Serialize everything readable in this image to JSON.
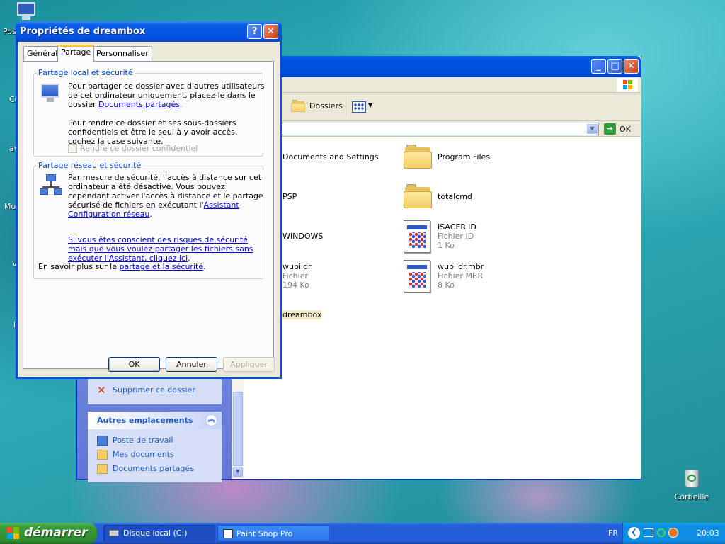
{
  "desktop": {
    "icons": [
      {
        "label": "Corbeille",
        "icon": "recycle-bin-icon"
      }
    ],
    "fragments": [
      "Pos",
      "Co",
      "av",
      "Mo",
      "V",
      "I"
    ]
  },
  "explorer": {
    "address_go": "OK",
    "toolbar": {
      "folders_label": "Dossiers"
    },
    "tasks": {
      "delete_folder": "Supprimer ce dossier",
      "other_places_title": "Autres emplacements",
      "other_places": [
        "Poste de travail",
        "Mes documents",
        "Documents partagés"
      ]
    },
    "files": [
      {
        "name": "Documents and Settings",
        "kind": "folder"
      },
      {
        "name": "Program Files",
        "kind": "folder"
      },
      {
        "name": "PSP",
        "kind": "folder"
      },
      {
        "name": "totalcmd",
        "kind": "folder"
      },
      {
        "name": "WINDOWS",
        "kind": "folder"
      },
      {
        "name": "ISACER.ID",
        "type": "Fichier ID",
        "size": "1 Ko",
        "kind": "file"
      },
      {
        "name": "wubildr",
        "type": "Fichier",
        "size": "194 Ko",
        "kind": "file"
      },
      {
        "name": "wubildr.mbr",
        "type": "Fichier MBR",
        "size": "8 Ko",
        "kind": "file"
      },
      {
        "name": "dreambox",
        "kind": "folder"
      }
    ]
  },
  "dialog": {
    "title": "Propriétés de dreambox",
    "tabs": [
      "Général",
      "Partage",
      "Personnaliser"
    ],
    "active_tab": "Partage",
    "local_group": {
      "title": "Partage local et sécurité",
      "p1_text": "Pour partager ce dossier avec d'autres utilisateurs de cet ordinateur uniquement, placez-le dans le dossier",
      "p1_link": "Documents partagés",
      "p1_end": ".",
      "p2_text": "Pour rendre ce dossier et ses sous-dossiers confidentiels et être le seul à y avoir accès, cochez la case suivante.",
      "checkbox_label": "Rendre ce dossier confidentiel",
      "checkbox_checked": false
    },
    "network_group": {
      "title": "Partage réseau et sécurité",
      "p1_text": "Par mesure de sécurité, l'accès à distance sur cet ordinateur a été désactivé. Vous pouvez cependant activer l'accès à distance et le partage sécurisé de fichiers en exécutant l'",
      "p1_link": "Assistant Configuration réseau",
      "p1_end": ".",
      "risk_link": "Si vous êtes conscient des risques de sécurité mais que vous voulez partager les fichiers sans exécuter l'Assistant, cliquez ici",
      "risk_end": "."
    },
    "learn_more_text": "En savoir plus sur le",
    "learn_more_link": "partage et la sécurité",
    "learn_more_end": ".",
    "buttons": {
      "ok": "OK",
      "cancel": "Annuler",
      "apply": "Appliquer"
    }
  },
  "taskbar": {
    "start_label": "démarrer",
    "tasks": [
      {
        "label": "Disque local (C:)",
        "active": true
      },
      {
        "label": "Paint Shop Pro",
        "active": false
      }
    ],
    "tray": {
      "language": "FR",
      "time": "20:03"
    }
  },
  "colors": {
    "xp_blue": "#0054e3",
    "start_green": "#3c9d3c",
    "link_blue": "#0046d5"
  }
}
